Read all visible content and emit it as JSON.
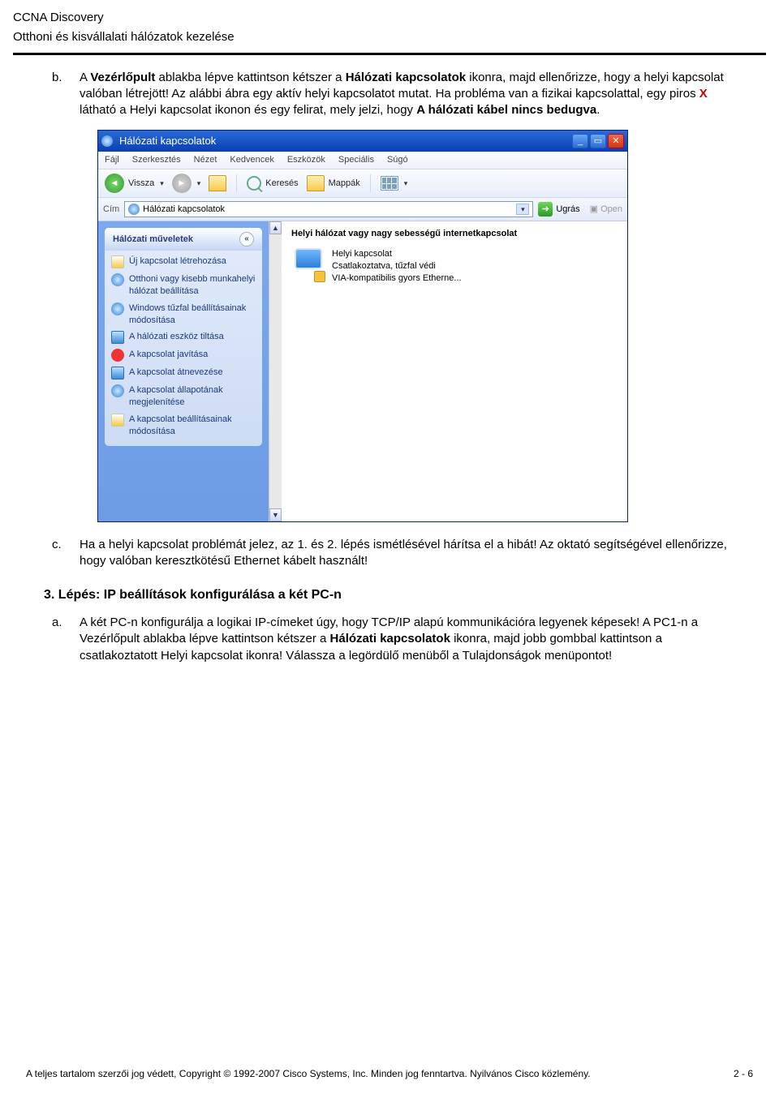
{
  "header": {
    "title1": "CCNA Discovery",
    "title2": "Otthoni és kisvállalati hálózatok kezelése"
  },
  "para_b": {
    "marker": "b.",
    "t1": "A ",
    "bold1": "Vezérlőpult",
    "t2": " ablakba lépve kattintson kétszer a ",
    "bold2": "Hálózati kapcsolatok",
    "t3": " ikonra, majd ellenőrizze, hogy a helyi kapcsolat valóban létrejött! Az alábbi ábra egy aktív helyi kapcsolatot mutat. Ha probléma van a fizikai kapcsolattal, egy piros ",
    "redX": "X",
    "t4": " látható a Helyi kapcsolat ikonon és egy felirat, mely jelzi, hogy ",
    "bold3": "A hálózati kábel nincs bedugva",
    "t5": "."
  },
  "para_c": {
    "marker": "c.",
    "text": "Ha a helyi kapcsolat problémát jelez, az 1. és 2. lépés ismétlésével hárítsa el a hibát! Az oktató segítségével ellenőrizze, hogy valóban keresztkötésű Ethernet kábelt használt!"
  },
  "step3_heading": "3. Lépés: IP beállítások konfigurálása a két PC-n",
  "para_a": {
    "marker": "a.",
    "t1": "A két PC-n konfigurálja a logikai IP-címeket úgy, hogy TCP/IP alapú kommunikációra legyenek képesek! A PC1-n a Vezérlőpult ablakba lépve kattintson kétszer a ",
    "bold1": "Hálózati kapcsolatok",
    "t2": " ikonra, majd jobb gombbal kattintson a csatlakoztatott Helyi kapcsolat ikonra! Válassza a legördülő menüből a Tulajdonságok menüpontot!"
  },
  "window": {
    "title": "Hálózati kapcsolatok",
    "menu": [
      "Fájl",
      "Szerkesztés",
      "Nézet",
      "Kedvencek",
      "Eszközök",
      "Speciális",
      "Súgó"
    ],
    "toolbar": {
      "back": "Vissza",
      "search": "Keresés",
      "folders": "Mappák"
    },
    "address": {
      "label": "Cím",
      "value": "Hálózati kapcsolatok",
      "go": "Ugrás",
      "open": "Open"
    },
    "tasks_title": "Hálózati műveletek",
    "tasks": [
      "Új kapcsolat létrehozása",
      "Otthoni vagy kisebb munkahelyi hálózat beállítása",
      "Windows tűzfal beállításainak módosítása",
      "A hálózati eszköz tiltása",
      "A kapcsolat javítása",
      "A kapcsolat átnevezése",
      "A kapcsolat állapotának megjelenítése",
      "A kapcsolat beállításainak módosítása"
    ],
    "category": "Helyi hálózat vagy nagy sebességű internetkapcsolat",
    "conn": {
      "name": "Helyi kapcsolat",
      "status": "Csatlakoztatva, tűzfal védi",
      "adapter": "VIA-kompatibilis gyors Etherne..."
    }
  },
  "footer": {
    "left": "A teljes tartalom szerzői jog védett, Copyright © 1992-2007 Cisco Systems, Inc. Minden jog fenntartva. Nyilvános Cisco közlemény.",
    "right": "2 - 6"
  }
}
